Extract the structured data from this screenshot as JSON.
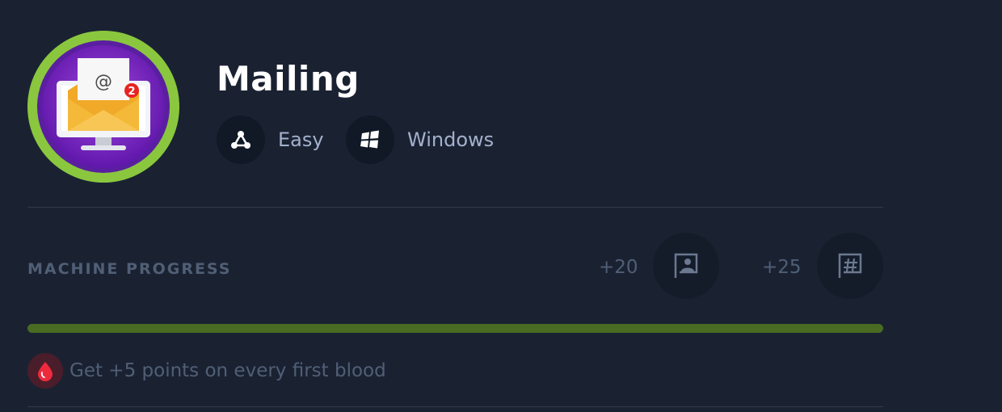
{
  "machine": {
    "name": "Mailing",
    "avatar_badge": "2",
    "avatar_symbol": "@",
    "difficulty": "Easy",
    "os": "Windows",
    "difficulty_icon": "difficulty-icon",
    "os_icon": "windows-icon",
    "accent_color": "#8ac73e"
  },
  "progress": {
    "label": "MACHINE PROGRESS",
    "user_points": "+20",
    "root_points": "+25",
    "user_flag_icon": "user-flag-icon",
    "root_flag_icon": "root-flag-icon",
    "fraction": 1.0,
    "bar_color": "#4a6b22"
  },
  "first_blood": {
    "text": "Get +5 points on every first blood",
    "icon": "blood-drop-icon"
  }
}
